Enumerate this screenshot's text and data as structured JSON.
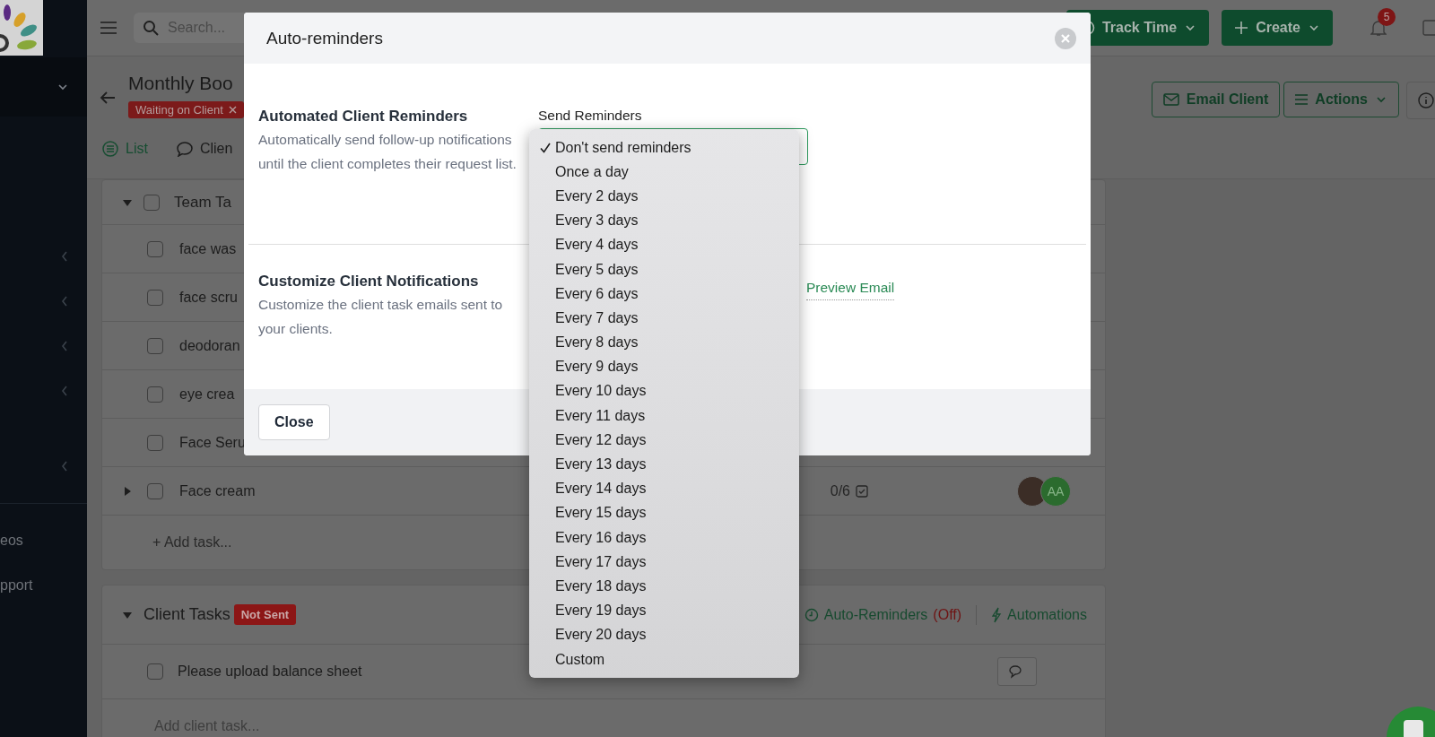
{
  "sidebar": {
    "items": [
      {
        "label": "eos"
      },
      {
        "label": "pport"
      }
    ]
  },
  "topbar": {
    "search": {
      "placeholder": "Search..."
    },
    "buttons": [
      {
        "label": "Track Time",
        "kind": "track"
      },
      {
        "label": "Create",
        "kind": "create"
      }
    ],
    "notifications": {
      "count": "5"
    }
  },
  "page": {
    "title": "Monthly Boo",
    "status_tag": "Waiting on Client",
    "actions": [
      {
        "label": "Email Client",
        "kind": "email"
      },
      {
        "label": "Actions",
        "kind": "menu"
      }
    ],
    "tabs": [
      {
        "label": "List",
        "selected": true,
        "kind": "list"
      },
      {
        "label": "Clien",
        "selected": false,
        "kind": "chat"
      }
    ]
  },
  "team_tasks": {
    "title": "Team Ta",
    "expanded": true,
    "checked": false,
    "tasks": [
      {
        "name": "face was",
        "checked": false
      },
      {
        "name": "face scru",
        "checked": false
      },
      {
        "name": "deodoran",
        "checked": false
      },
      {
        "name": "eye crea",
        "checked": false
      },
      {
        "name": "Face Seru",
        "checked": false
      },
      {
        "name": "Face cream",
        "checked": false,
        "subtasks": {
          "expanded": false,
          "progress": "0/6"
        },
        "assignees": [
          {
            "kind": "photo"
          },
          {
            "kind": "initials",
            "initials": "AA"
          }
        ]
      }
    ],
    "add_task": "+ Add task..."
  },
  "client_tasks": {
    "title": "Client Tasks",
    "expanded": true,
    "badge": "Not Sent",
    "auto_reminders": {
      "label": "Auto-Reminders",
      "state": "(Off)"
    },
    "automations": "Automations",
    "tasks": [
      {
        "name": "Please upload balance sheet",
        "checked": false
      }
    ],
    "add_placeholder": "Add client task..."
  },
  "modal": {
    "title": "Auto-reminders",
    "sections": [
      {
        "title": "Automated Client Reminders",
        "description": "Automatically send follow-up notifications until the client completes their request list.",
        "field_label": "Send Reminders"
      },
      {
        "title": "Customize Client Notifications",
        "description": "Customize the client task emails sent to your clients.",
        "link": "Preview Email"
      }
    ],
    "buttons": [
      "Close"
    ]
  },
  "reminder_menu": {
    "options": [
      {
        "label": "Don't send reminders",
        "selected": true
      },
      {
        "label": "Once a day",
        "selected": false
      },
      {
        "label": "Every 2 days",
        "selected": false
      },
      {
        "label": "Every 3 days",
        "selected": false
      },
      {
        "label": "Every 4 days",
        "selected": false
      },
      {
        "label": "Every 5 days",
        "selected": false
      },
      {
        "label": "Every 6 days",
        "selected": false
      },
      {
        "label": "Every 7 days",
        "selected": false
      },
      {
        "label": "Every 8 days",
        "selected": false
      },
      {
        "label": "Every 9 days",
        "selected": false
      },
      {
        "label": "Every 10 days",
        "selected": false
      },
      {
        "label": "Every 11 days",
        "selected": false
      },
      {
        "label": "Every 12 days",
        "selected": false
      },
      {
        "label": "Every 13 days",
        "selected": false
      },
      {
        "label": "Every 14 days",
        "selected": false
      },
      {
        "label": "Every 15 days",
        "selected": false
      },
      {
        "label": "Every 16 days",
        "selected": false
      },
      {
        "label": "Every 17 days",
        "selected": false
      },
      {
        "label": "Every 18 days",
        "selected": false
      },
      {
        "label": "Every 19 days",
        "selected": false
      },
      {
        "label": "Every 20 days",
        "selected": false
      },
      {
        "label": "Custom",
        "selected": false
      }
    ]
  }
}
